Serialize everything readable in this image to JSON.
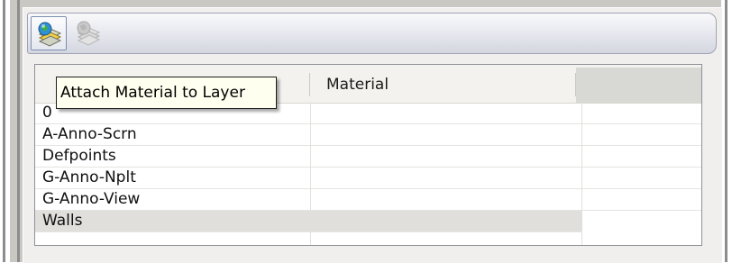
{
  "toolbar": {
    "buttons": [
      {
        "icon": "attach-material-icon",
        "enabled": true
      },
      {
        "icon": "detach-material-icon",
        "enabled": false
      }
    ]
  },
  "tooltip": {
    "text": "Attach Material to Layer"
  },
  "table": {
    "columns": [
      "",
      "Material",
      ""
    ],
    "rows": [
      {
        "layer": "0",
        "material": ""
      },
      {
        "layer": "A-Anno-Scrn",
        "material": ""
      },
      {
        "layer": "Defpoints",
        "material": ""
      },
      {
        "layer": "G-Anno-Nplt",
        "material": ""
      },
      {
        "layer": "G-Anno-View",
        "material": ""
      },
      {
        "layer": "Walls",
        "material": "",
        "selected": true
      }
    ]
  },
  "colors": {
    "selection": "#e0dfdc",
    "tooltip_background": "#fffff0",
    "toolbar_border": "#9ea4b3"
  }
}
